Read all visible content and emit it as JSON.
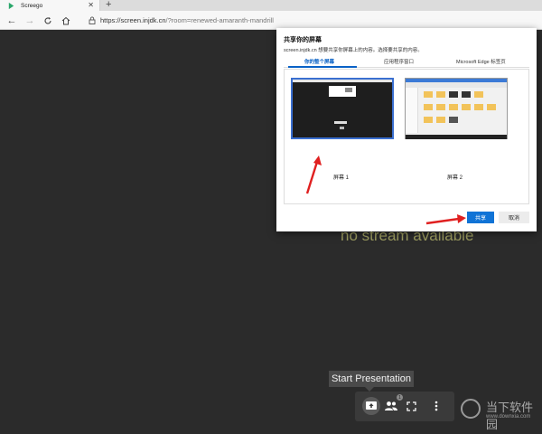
{
  "browser": {
    "tab_title": "Screego",
    "url_host": "https://screen.injdk.cn",
    "url_path": "/?room=renewed-amaranth-mandrill"
  },
  "page": {
    "message": "no stream available",
    "tooltip": "Start Presentation",
    "users_badge": "1"
  },
  "dialog": {
    "title": "共享你的屏幕",
    "description": "screen.injdk.cn 想要共享你屏幕上的内容。选择要共享的内容。",
    "tabs": [
      "你的整个屏幕",
      "应用程序窗口",
      "Microsoft Edge 标签页"
    ],
    "screens": [
      "屏幕 1",
      "屏幕 2"
    ],
    "share_label": "共享",
    "cancel_label": "取消"
  },
  "watermark": {
    "cn": "当下软件园",
    "en": "www.downxia.com"
  }
}
